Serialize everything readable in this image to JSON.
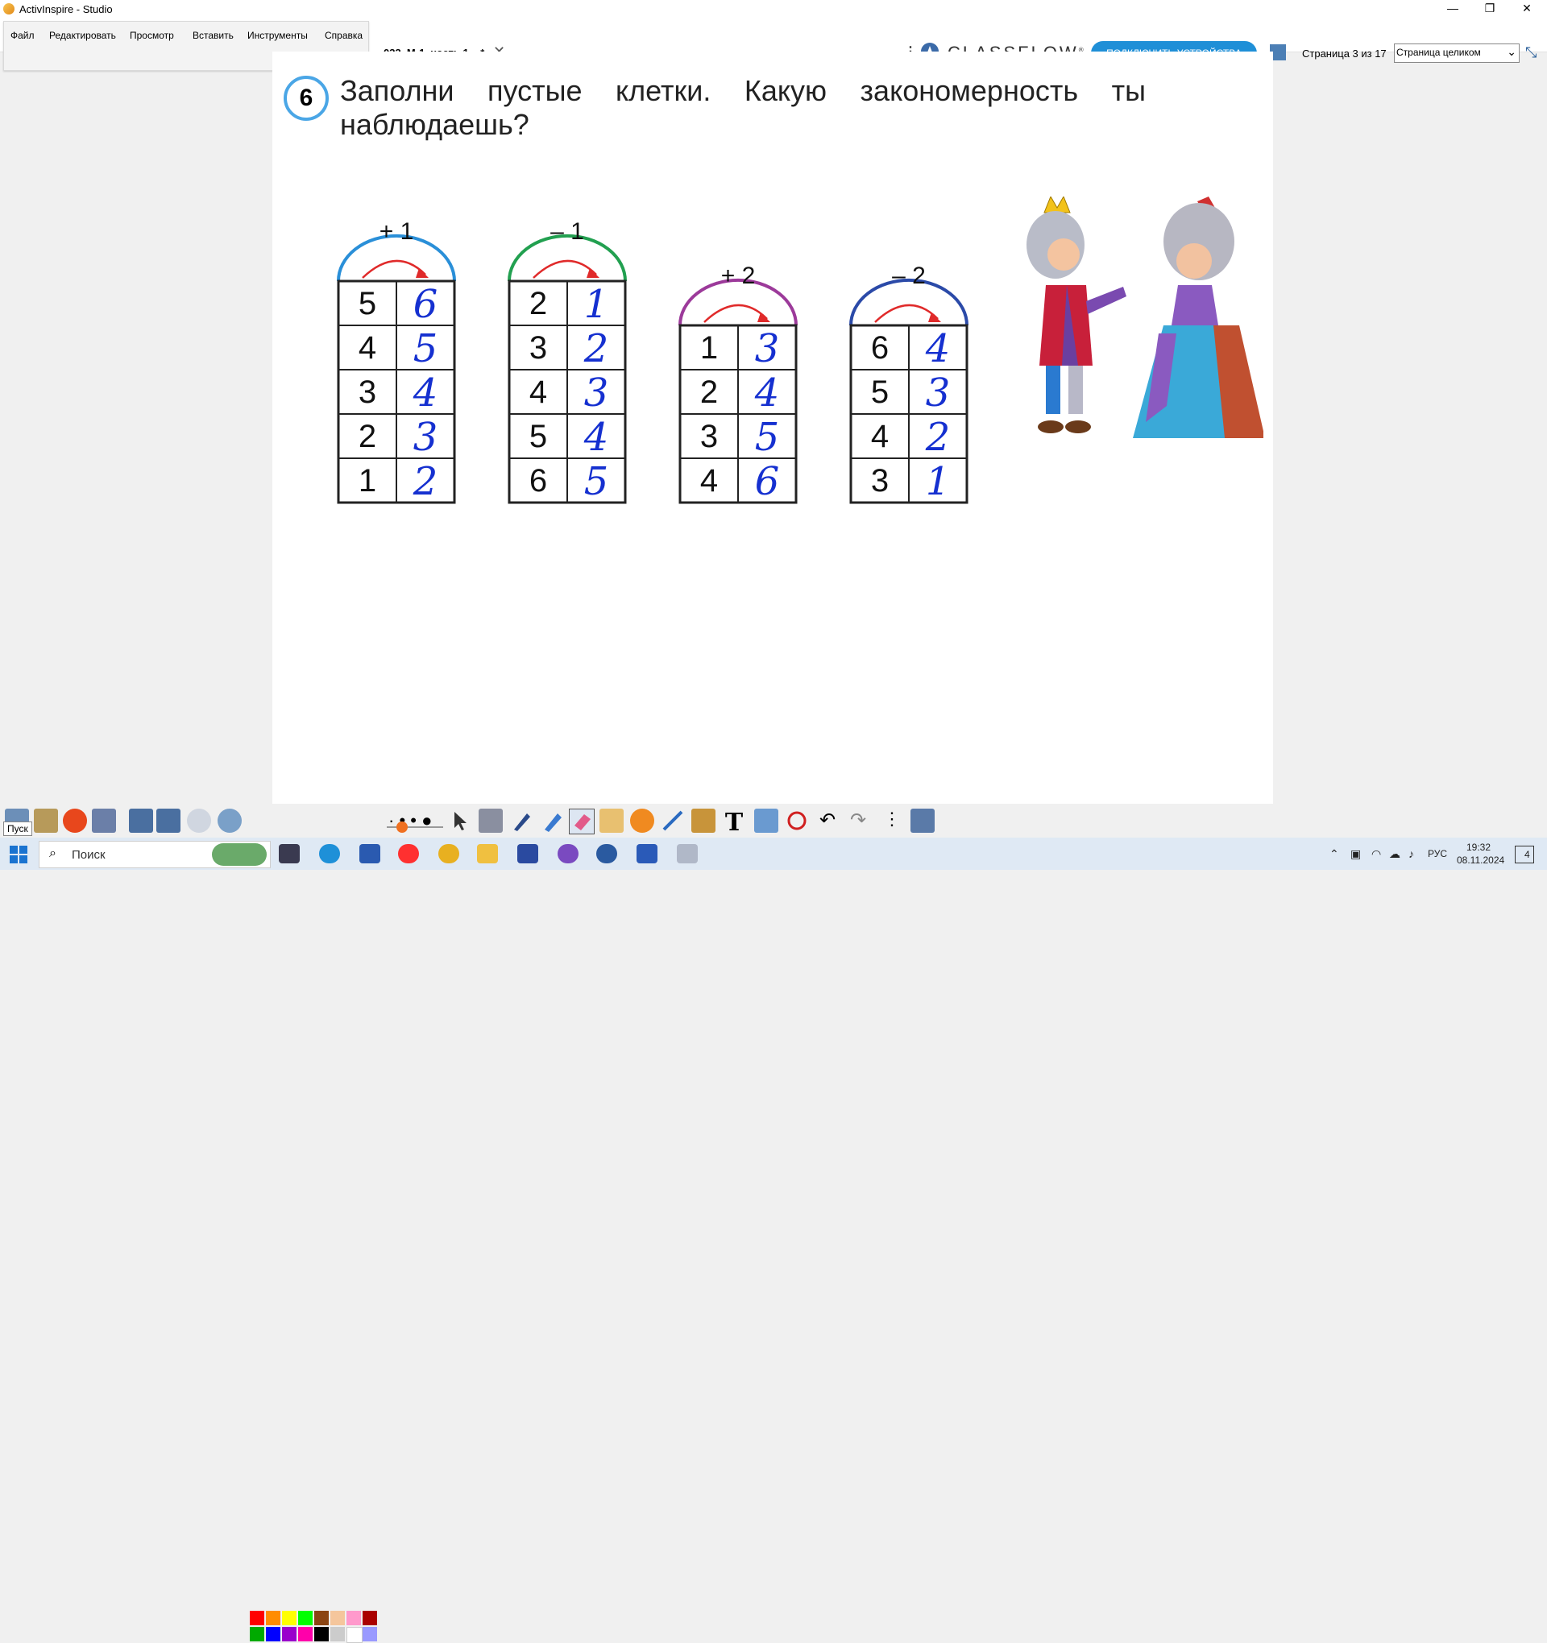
{
  "window": {
    "title": "ActivInspire - Studio",
    "minimize": "—",
    "restore": "❐",
    "close": "✕"
  },
  "menu": {
    "items": [
      "Файл",
      "Редактировать",
      "Просмотр",
      "Вставить",
      "Инструменты",
      "Справка"
    ]
  },
  "tab": {
    "label": "033_М-1_часть 1... *",
    "close": "✕"
  },
  "header": {
    "logo": "CLASSFLOW",
    "connect_label": "ПОДКЛЮЧИТЬ УСТРОЙСТВА",
    "page_indicator": "Страница 3 из 17",
    "zoom_value": "Страница целиком"
  },
  "task": {
    "number": "6",
    "text": "Заполни пустые клетки. Какую закономерность ты наблюдаешь?"
  },
  "tables": [
    {
      "op": "+ 1",
      "color": "#2a8fd8",
      "printed": [
        "5",
        "4",
        "3",
        "2",
        "1"
      ],
      "handwritten": [
        "6",
        "5",
        "4",
        "3",
        "2"
      ]
    },
    {
      "op": "– 1",
      "color": "#22a050",
      "printed": [
        "2",
        "3",
        "4",
        "5",
        "6"
      ],
      "handwritten": [
        "1",
        "2",
        "3",
        "4",
        "5"
      ]
    },
    {
      "op": "+ 2",
      "color": "#9c3a9a",
      "printed": [
        "1",
        "2",
        "3",
        "4"
      ],
      "handwritten": [
        "3",
        "4",
        "5",
        "6"
      ]
    },
    {
      "op": "– 2",
      "color": "#2b4aa8",
      "printed": [
        "6",
        "5",
        "4",
        "3"
      ],
      "handwritten": [
        "4",
        "3",
        "2",
        "1"
      ]
    }
  ],
  "palette": {
    "row1": [
      "#ff0000",
      "#ff8c00",
      "#ffff00",
      "#00ff00",
      "#8b4513",
      "#f5c69c",
      "#ff99cc",
      "#aa0000"
    ],
    "row2": [
      "#00aa00",
      "#0000ff",
      "#9900cc",
      "#ff00aa",
      "#000000",
      "#cccccc",
      "#ffffff",
      "#9999ff"
    ]
  },
  "tooltip": "Пуск",
  "taskbar": {
    "search_placeholder": "Поиск",
    "lang": "РУС",
    "time": "19:32",
    "date": "08.11.2024",
    "notifications": "4"
  }
}
